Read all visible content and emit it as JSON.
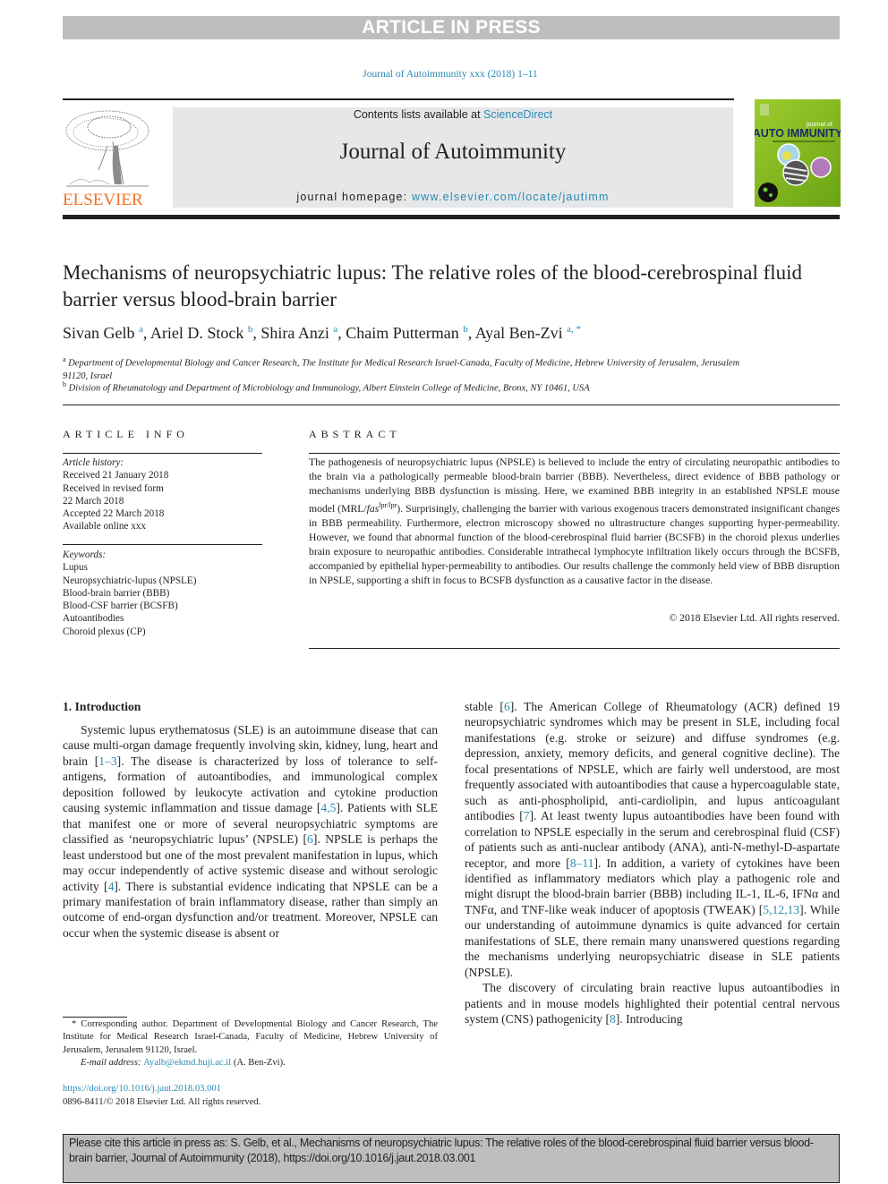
{
  "banner": {
    "label": "ARTICLE IN PRESS"
  },
  "journal_ref": "Journal of Autoimmunity xxx (2018) 1–11",
  "masthead": {
    "contents_prefix": "Contents lists available at ",
    "contents_link": "ScienceDirect",
    "journal_name": "Journal of Autoimmunity",
    "homepage_prefix": "journal homepage: ",
    "homepage_link": "www.elsevier.com/locate/jautimm",
    "publisher_logo_text": "ELSEVIER",
    "cover": {
      "small_text": "journal of",
      "big_text": "AUTO IMMUNITY"
    }
  },
  "article": {
    "title": "Mechanisms of neuropsychiatric lupus: The relative roles of the blood-cerebrospinal fluid barrier versus blood-brain barrier",
    "authors": [
      {
        "name": "Sivan Gelb",
        "sup": "a"
      },
      {
        "name": "Ariel D. Stock",
        "sup": "b"
      },
      {
        "name": "Shira Anzi",
        "sup": "a"
      },
      {
        "name": "Chaim Putterman",
        "sup": "b"
      },
      {
        "name": "Ayal Ben-Zvi",
        "sup": "a, *"
      }
    ],
    "affiliations": [
      {
        "sup": "a",
        "text": "Department of Developmental Biology and Cancer Research, The Institute for Medical Research Israel-Canada, Faculty of Medicine, Hebrew University of Jerusalem, Jerusalem 91120, Israel"
      },
      {
        "sup": "b",
        "text": "Division of Rheumatology and Department of Microbiology and Immunology, Albert Einstein College of Medicine, Bronx, NY 10461, USA"
      }
    ]
  },
  "article_info": {
    "heading": "ARTICLE INFO",
    "history_label": "Article history:",
    "history": [
      "Received 21 January 2018",
      "Received in revised form",
      "22 March 2018",
      "Accepted 22 March 2018",
      "Available online xxx"
    ],
    "keywords_label": "Keywords:",
    "keywords": [
      "Lupus",
      "Neuropsychiatric-lupus (NPSLE)",
      "Blood-brain barrier (BBB)",
      "Blood-CSF barrier (BCSFB)",
      "Autoantibodies",
      "Choroid plexus (CP)"
    ]
  },
  "abstract": {
    "heading": "ABSTRACT",
    "text_1": "The pathogenesis of neuropsychiatric lupus (NPSLE) is believed to include the entry of circulating neuropathic antibodies to the brain via a pathologically permeable blood-brain barrier (BBB). Nevertheless, direct evidence of BBB pathology or mechanisms underlying BBB dysfunction is missing. Here, we examined BBB integrity in an established NPSLE mouse model (MRL/",
    "italic": "fas",
    "sup": "lpr/lpr",
    "text_2": "). Surprisingly, challenging the barrier with various exogenous tracers demonstrated insignificant changes in BBB permeability. Furthermore, electron microscopy showed no ultrastructure changes supporting hyper-permeability. However, we found that abnormal function of the blood-cerebrospinal fluid barrier (BCSFB) in the choroid plexus underlies brain exposure to neuropathic antibodies. Considerable intrathecal lymphocyte infiltration likely occurs through the BCSFB, accompanied by epithelial hyper-permeability to antibodies. Our results challenge the commonly held view of BBB disruption in NPSLE, supporting a shift in focus to BCSFB dysfunction as a causative factor in the disease.",
    "copyright": "© 2018 Elsevier Ltd. All rights reserved."
  },
  "intro": {
    "heading": "1.  Introduction",
    "left_p1": [
      {
        "t": "Systemic lupus erythematosus (SLE) is an autoimmune disease that can cause multi-organ damage frequently involving skin, kidney, lung, heart and brain ["
      },
      {
        "r": "1–3"
      },
      {
        "t": "]. The disease is characterized by loss of tolerance to self-antigens, formation of autoantibodies, and immunological complex deposition followed by leukocyte activation and cytokine production causing systemic inflammation and tissue damage ["
      },
      {
        "r": "4,5"
      },
      {
        "t": "]. Patients with SLE that manifest one or more of several neuropsychiatric symptoms are classified as ‘neuropsychiatric lupus’ (NPSLE) ["
      },
      {
        "r": "6"
      },
      {
        "t": "]. NPSLE is perhaps the least understood but one of the most prevalent manifestation in lupus, which may occur independently of active systemic disease and without serologic activity ["
      },
      {
        "r": "4"
      },
      {
        "t": "]. There is substantial evidence indicating that NPSLE can be a primary manifestation of brain inflammatory disease, rather than simply an outcome of end-organ dysfunction and/or treatment. Moreover, NPSLE can occur when the systemic disease is absent or"
      }
    ],
    "right_p1": [
      {
        "t": "stable ["
      },
      {
        "r": "6"
      },
      {
        "t": "]. The American College of Rheumatology (ACR) defined 19 neuropsychiatric syndromes which may be present in SLE, including focal manifestations (e.g. stroke or seizure) and diffuse syndromes (e.g. depression, anxiety, memory deficits, and general cognitive decline). The focal presentations of NPSLE, which are fairly well understood, are most frequently associated with autoantibodies that cause a hypercoagulable state, such as anti-phospholipid, anti-cardiolipin, and lupus anticoagulant antibodies ["
      },
      {
        "r": "7"
      },
      {
        "t": "]. At least twenty lupus autoantibodies have been found with correlation to NPSLE especially in the serum and cerebrospinal fluid (CSF) of patients such as anti-nuclear antibody (ANA), anti-N-methyl-D-aspartate receptor, and more ["
      },
      {
        "r": "8–11"
      },
      {
        "t": "]. In addition, a variety of cytokines have been identified as inflammatory mediators which play a pathogenic role and might disrupt the blood-brain barrier (BBB) including IL-1, IL-6, IFNα and TNFα, and TNF-like weak inducer of apoptosis (TWEAK) ["
      },
      {
        "r": "5,12,13"
      },
      {
        "t": "]. While our understanding of autoimmune dynamics is quite advanced for certain manifestations of SLE, there remain many unanswered questions regarding the mechanisms underlying neuropsychiatric disease in SLE patients (NPSLE)."
      }
    ],
    "right_p2": [
      {
        "t": "The discovery of circulating brain reactive lupus autoantibodies in patients and in mouse models highlighted their potential central nervous system (CNS) pathogenicity ["
      },
      {
        "r": "8"
      },
      {
        "t": "]. Introducing"
      }
    ]
  },
  "footnote": {
    "corresponding": "* Corresponding author. Department of Developmental Biology and Cancer Research, The Institute for Medical Research Israel-Canada, Faculty of Medicine, Hebrew University of Jerusalem, Jerusalem 91120, Israel.",
    "email_label": "E-mail address: ",
    "email": "Ayalb@ekmd.huji.ac.il",
    "email_suffix": " (A. Ben-Zvi).",
    "doi": "https://doi.org/10.1016/j.jaut.2018.03.001",
    "issn": "0896-8411/© 2018 Elsevier Ltd. All rights reserved."
  },
  "cite_box": {
    "text": "Please cite this article in press as: S. Gelb, et al., Mechanisms of neuropsychiatric lupus: The relative roles of the blood-cerebrospinal fluid barrier versus blood-brain barrier, Journal of Autoimmunity (2018), https://doi.org/10.1016/j.jaut.2018.03.001"
  },
  "colors": {
    "link": "#2a8ab3",
    "banner_gray": "#bdbebf",
    "masthead_gray": "#e6e7e8",
    "elsevier_orange": "#f37021"
  }
}
